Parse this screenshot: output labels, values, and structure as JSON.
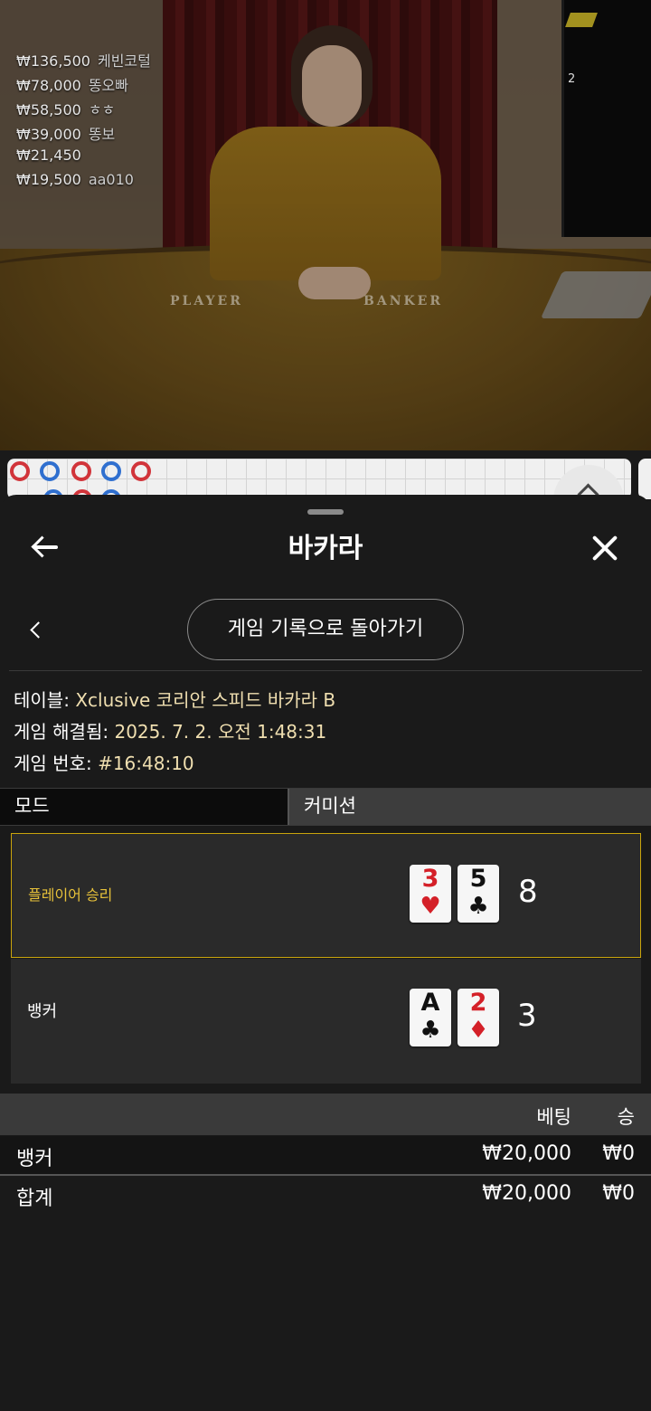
{
  "video": {
    "leaderboard": [
      {
        "amount": "₩136,500",
        "name": "케빈코털"
      },
      {
        "amount": "₩78,000",
        "name": "똥오빠"
      },
      {
        "amount": "₩58,500",
        "name": "ㅎㅎ"
      },
      {
        "amount": "₩39,000",
        "name": "똥보"
      },
      {
        "amount": "₩21,450",
        "name": ""
      },
      {
        "amount": "₩19,500",
        "name": "aa010"
      }
    ],
    "counter": "2",
    "table_player": "PLAYER",
    "table_banker": "BANKER"
  },
  "header": {
    "title": "바카라",
    "back_icon": "arrow-left-icon",
    "close_icon": "close-icon"
  },
  "subnav": {
    "return_label": "게임 기록으로 돌아가기"
  },
  "info": {
    "table_label": "테이블:",
    "table_value": "Xclusive 코리안 스피드 바카라 B",
    "resolved_label": "게임 해결됨:",
    "resolved_value": "2025. 7. 2. 오전 1:48:31",
    "number_label": "게임 번호:",
    "number_value": "#16:48:10"
  },
  "tabs": {
    "mode": "모드",
    "commission": "커미션"
  },
  "results": {
    "player": {
      "label": "플레이어 승리",
      "cards": [
        {
          "rank": "3",
          "suit": "♥",
          "color": "#d42028"
        },
        {
          "rank": "5",
          "suit": "♣",
          "color": "#111111"
        }
      ],
      "score": "8"
    },
    "banker": {
      "label": "뱅커",
      "cards": [
        {
          "rank": "A",
          "suit": "♣",
          "color": "#111111"
        },
        {
          "rank": "2",
          "suit": "♦",
          "color": "#d42028"
        }
      ],
      "score": "3"
    }
  },
  "bets": {
    "col_bet": "베팅",
    "col_win": "승",
    "rows": [
      {
        "name": "뱅커",
        "amount": "₩20,000",
        "win": "₩0"
      },
      {
        "name": "합계",
        "amount": "₩20,000",
        "win": "₩0"
      }
    ]
  },
  "colors": {
    "accent_gold": "#c9a40c",
    "player_red": "#d1343a",
    "banker_blue": "#2f6fcf"
  }
}
